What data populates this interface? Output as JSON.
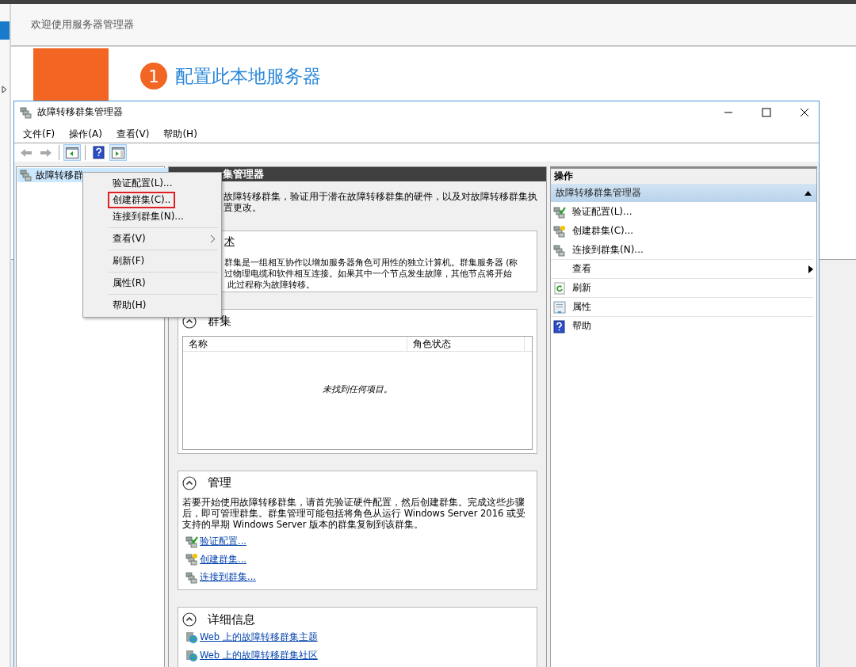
{
  "background": {
    "welcome_title": "欢迎使用服务器管理器",
    "quick_start": {
      "step": "1",
      "title": "配置此本地服务器"
    }
  },
  "window": {
    "title": "故障转移群集管理器",
    "menu": [
      "文件(F)",
      "操作(A)",
      "查看(V)",
      "帮助(H)"
    ],
    "toolbar": [
      {
        "kind": "back",
        "disabled": true
      },
      {
        "kind": "forward",
        "disabled": true
      },
      {
        "kind": "separator"
      },
      {
        "kind": "console-tree",
        "on": true
      },
      {
        "kind": "separator"
      },
      {
        "kind": "help",
        "on": false
      },
      {
        "kind": "action-pane",
        "on": true
      }
    ]
  },
  "tree": {
    "items": [
      {
        "label": "故障转移群",
        "selected": true
      }
    ]
  },
  "center": {
    "header": "集管理器",
    "intro": [
      "故障转移群集，验证用于潜在故障转移群集的硬件，以及对故障转移群集执",
      "置更改。"
    ],
    "sections": [
      {
        "kind": "overview",
        "title": "术",
        "lines": [
          "群集是一组相互协作以增加服务器角色可用性的独立计算机。群集服务器 (称",
          "过物理电缆和软件相互连接。如果其中一个节点发生故障，其他节点将开始",
          "此过程称为故障转移。"
        ]
      },
      {
        "kind": "table",
        "title": "群集",
        "expanded": true,
        "columns": [
          "名称",
          "角色状态"
        ],
        "empty_message": "未找到任何项目。"
      },
      {
        "kind": "links",
        "title": "管理",
        "expanded": true,
        "text": "若要开始使用故障转移群集，请首先验证硬件配置，然后创建群集。完成这些步骤后，即可管理群集。群集管理可能包括将角色从运行 Windows Server 2016 或受支持的早期 Windows Server 版本的群集复制到该群集。",
        "links": [
          {
            "label": "验证配置...",
            "kind": "validate"
          },
          {
            "label": "创建群集...",
            "kind": "create"
          },
          {
            "label": "连接到群集...",
            "kind": "connect"
          }
        ]
      },
      {
        "kind": "links",
        "title": "详细信息",
        "expanded": true,
        "links": [
          {
            "label": "Web 上的故障转移群集主题",
            "kind": "web"
          },
          {
            "label": "Web 上的故障转移群集社区",
            "kind": "web"
          }
        ]
      }
    ]
  },
  "actions": {
    "title": "操作",
    "group": {
      "label": "故障转移群集管理器",
      "expanded": true
    },
    "items": [
      {
        "label": "验证配置(L)...",
        "kind": "validate",
        "separator_before": false
      },
      {
        "label": "创建群集(C)...",
        "kind": "create",
        "separator_before": false
      },
      {
        "label": "连接到群集(N)...",
        "kind": "connect",
        "separator_before": false
      },
      {
        "label": "查看",
        "kind": "submenu",
        "separator_before": true
      },
      {
        "label": "刷新",
        "kind": "refresh",
        "separator_before": true
      },
      {
        "label": "属性",
        "kind": "properties",
        "separator_before": true
      },
      {
        "label": "帮助",
        "kind": "help",
        "separator_before": true
      }
    ]
  },
  "context_menu": {
    "items": [
      {
        "label": "验证配置(L)...",
        "kind": "item",
        "selected": false,
        "separator_before": false
      },
      {
        "label": "创建群集(C)..",
        "kind": "item",
        "selected": true,
        "separator_before": false
      },
      {
        "label": "连接到群集(N)...",
        "kind": "item",
        "selected": false,
        "separator_before": false
      },
      {
        "label": "查看(V)",
        "kind": "submenu",
        "selected": false,
        "separator_before": true
      },
      {
        "label": "刷新(F)",
        "kind": "item",
        "selected": false,
        "separator_before": true
      },
      {
        "label": "属性(R)",
        "kind": "item",
        "selected": false,
        "separator_before": true
      },
      {
        "label": "帮助(H)",
        "kind": "item",
        "selected": false,
        "separator_before": true
      }
    ]
  }
}
